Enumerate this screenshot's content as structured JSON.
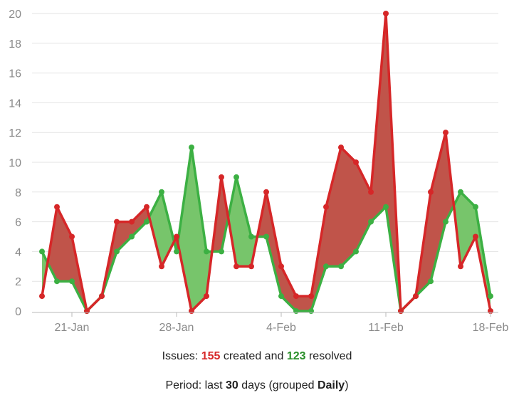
{
  "chart_data": {
    "type": "area",
    "x_start": "2024-01-19",
    "x_step_days": 1,
    "x_tick_labels": [
      "21-Jan",
      "28-Jan",
      "4-Feb",
      "11-Feb",
      "18-Feb"
    ],
    "ylim": [
      0,
      20
    ],
    "y_ticks": [
      0,
      2,
      4,
      6,
      8,
      10,
      12,
      14,
      16,
      18,
      20
    ],
    "grid": true,
    "series": [
      {
        "name": "created",
        "color": "#d62728",
        "values": [
          1,
          7,
          5,
          0,
          1,
          6,
          6,
          7,
          3,
          5,
          0,
          1,
          9,
          3,
          3,
          8,
          3,
          1,
          1,
          7,
          11,
          10,
          8,
          20,
          0,
          1,
          8,
          12,
          3,
          5,
          0
        ]
      },
      {
        "name": "resolved",
        "color": "#3cb043",
        "values": [
          4,
          2,
          2,
          0,
          1,
          4,
          5,
          6,
          8,
          4,
          11,
          4,
          4,
          9,
          5,
          5,
          1,
          0,
          0,
          3,
          3,
          4,
          6,
          7,
          0,
          1,
          2,
          6,
          8,
          7,
          1
        ]
      }
    ]
  },
  "caption": {
    "issues_prefix": "Issues: ",
    "created_count": "155",
    "created_mid": " created and ",
    "resolved_count": "123",
    "resolved_suffix": " resolved",
    "period_prefix": "Period: last ",
    "period_days": "30",
    "period_mid": " days (grouped ",
    "period_group": "Daily",
    "period_suffix": ")"
  }
}
